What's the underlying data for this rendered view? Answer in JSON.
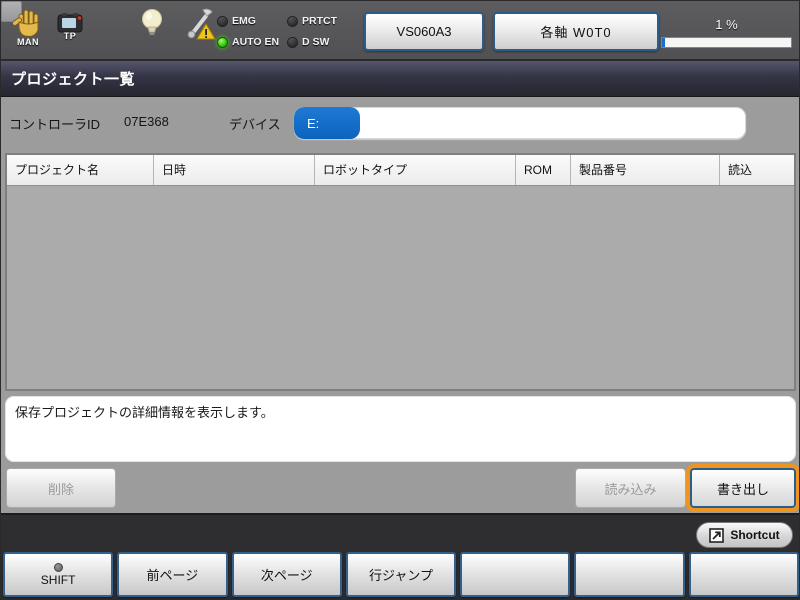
{
  "statusbar": {
    "man_label": "MAN",
    "tp_label": "TP",
    "leds": [
      {
        "label": "EMG",
        "on": false
      },
      {
        "label": "PRTCT",
        "on": false
      },
      {
        "label": "AUTO EN",
        "on": true
      },
      {
        "label": "D SW",
        "on": false
      }
    ],
    "robot_button": "VS060A3",
    "mode_button": "各軸 W0T0",
    "speed_text": "1 %",
    "speed_value": 1
  },
  "titlebar": {
    "title": "プロジェクト一覧"
  },
  "controller": {
    "id_label": "コントローラID",
    "id_value": "07E368",
    "device_label": "デバイス",
    "device_value": "E:"
  },
  "table": {
    "columns": [
      "プロジェクト名",
      "日時",
      "ロボットタイプ",
      "ROM",
      "製品番号",
      "読込"
    ],
    "rows": []
  },
  "detail": {
    "text": "保存プロジェクトの詳細情報を表示します。"
  },
  "actions": {
    "delete_label": "削除",
    "load_label": "読み込み",
    "export_label": "書き出し"
  },
  "shortcut": {
    "label": "Shortcut"
  },
  "function_keys": [
    {
      "label": "SHIFT",
      "has_indicator": true
    },
    {
      "label": "前ページ",
      "has_indicator": false
    },
    {
      "label": "次ページ",
      "has_indicator": false
    },
    {
      "label": "行ジャンプ",
      "has_indicator": false
    },
    {
      "label": "",
      "has_indicator": false
    },
    {
      "label": "",
      "has_indicator": false
    },
    {
      "label": "",
      "has_indicator": false
    }
  ],
  "colors": {
    "highlight_orange": "#ee9421",
    "led_green": "#35c40f",
    "device_blue": "#0b63bd",
    "title_bg": "#2e2e3e",
    "main_bg": "#9c9c9c",
    "band_bg": "#2e2e30"
  }
}
